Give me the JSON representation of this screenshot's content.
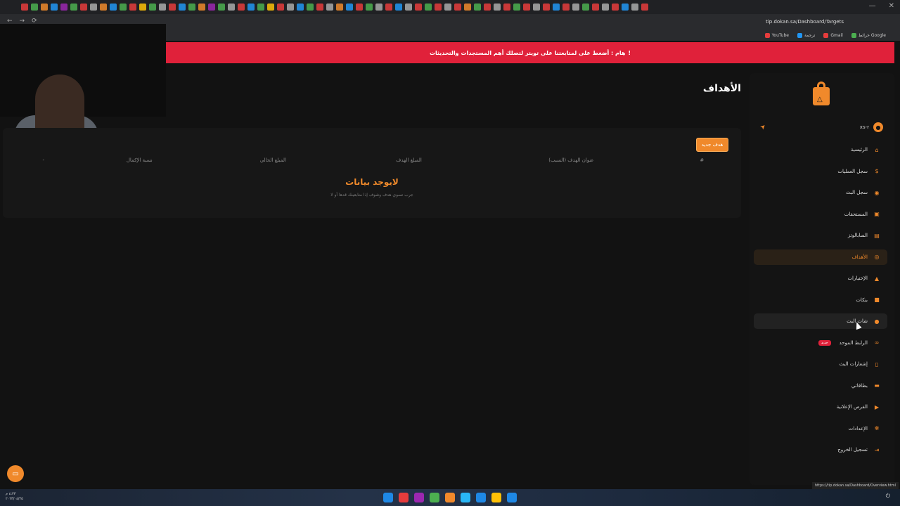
{
  "browser": {
    "url": "tip.dokan.sa/Dashboard/Targets",
    "tab_colors": [
      "#e63c3c",
      "#4caf50",
      "#f0892b",
      "#2196f3",
      "#9c27b0",
      "#4caf50",
      "#e63c3c",
      "#aaa",
      "#f0892b",
      "#2196f3",
      "#4caf50",
      "#e63c3c",
      "#ffc107",
      "#4caf50",
      "#aaa",
      "#e63c3c",
      "#2196f3",
      "#4caf50",
      "#f0892b",
      "#9c27b0",
      "#4caf50",
      "#aaa",
      "#e63c3c",
      "#2196f3",
      "#4caf50",
      "#ffc107",
      "#e63c3c",
      "#aaa",
      "#2196f3",
      "#4caf50",
      "#e63c3c",
      "#aaa",
      "#f0892b",
      "#2196f3",
      "#e63c3c",
      "#4caf50",
      "#aaa",
      "#e63c3c",
      "#2196f3",
      "#aaa",
      "#e63c3c",
      "#4caf50",
      "#e63c3c",
      "#aaa",
      "#e63c3c",
      "#f0892b",
      "#4caf50",
      "#e63c3c",
      "#aaa",
      "#e63c3c",
      "#4caf50",
      "#e63c3c",
      "#aaa",
      "#e63c3c",
      "#2196f3",
      "#e63c3c",
      "#aaa",
      "#4caf50",
      "#e63c3c",
      "#aaa",
      "#e63c3c",
      "#2196f3",
      "#aaa",
      "#e63c3c"
    ],
    "bookmarks": [
      {
        "label": "YouTube",
        "color": "#e63c3c"
      },
      {
        "label": "ترجمة",
        "color": "#2196f3"
      },
      {
        "label": "Gmail",
        "color": "#e63c3c"
      },
      {
        "label": "خرائط Google",
        "color": "#4caf50"
      }
    ],
    "status_url": "https://tip.dokan.sa/Dashboard/Overview.html"
  },
  "alert": {
    "text": "هام : أضغط على لمتابعتنا على تويتر لتصلك أهم المستجدات والتحديثات",
    "icon": "!"
  },
  "page": {
    "title": "الأهداف"
  },
  "card": {
    "new_button": "هدف جديد",
    "columns": [
      "#",
      "عنوان الهدف (السبب)",
      "المبلغ الهدف",
      "المبلغ الحالي",
      "نسبة الإكمال",
      "-"
    ],
    "empty_title": "لايوجد بيانات",
    "empty_sub": "جرب تسوي هدف وشوف إذا متابعينك قدها أو لا"
  },
  "sidebar": {
    "username": "xs-r",
    "items": [
      {
        "label": "الرئيسية",
        "icon": "home-icon",
        "glyph": "⌂",
        "state": ""
      },
      {
        "label": "سجل العمليات",
        "icon": "dollar-icon",
        "glyph": "$",
        "state": ""
      },
      {
        "label": "سجل البث",
        "icon": "broadcast-icon",
        "glyph": "◉",
        "state": ""
      },
      {
        "label": "المستحقات",
        "icon": "wallet-icon",
        "glyph": "▣",
        "state": ""
      },
      {
        "label": "السابالوتز",
        "icon": "document-icon",
        "glyph": "▤",
        "state": ""
      },
      {
        "label": "الأهداف",
        "icon": "target-icon",
        "glyph": "◎",
        "state": "active"
      },
      {
        "label": "الإختيارات",
        "icon": "vote-icon",
        "glyph": "▲",
        "state": ""
      },
      {
        "label": "بنكات",
        "icon": "bank-icon",
        "glyph": "■",
        "state": ""
      },
      {
        "label": "شات البث",
        "icon": "chat-icon",
        "glyph": "●",
        "state": "hover"
      },
      {
        "label": "الرابط الموحد",
        "icon": "link-icon",
        "glyph": "∞",
        "state": "",
        "badge": "جديد"
      },
      {
        "label": "إشعارات البث",
        "icon": "phone-icon",
        "glyph": "▯",
        "state": ""
      },
      {
        "label": "بطاقاتي",
        "icon": "card-icon",
        "glyph": "▬",
        "state": ""
      },
      {
        "label": "الفرص الإعلانية",
        "icon": "ad-icon",
        "glyph": "▶",
        "state": ""
      },
      {
        "label": "الإعدادات",
        "icon": "gear-icon",
        "glyph": "✻",
        "state": ""
      },
      {
        "label": "تسجيل الخروج",
        "icon": "logout-icon",
        "glyph": "⇥",
        "state": ""
      }
    ]
  },
  "taskbar": {
    "clock_time": "٤:٣٣ م",
    "clock_date": "٢٠٢٣/٠٤/٢٥",
    "icon_colors": [
      "#1e88e5",
      "#e63c3c",
      "#9c27b0",
      "#4caf50",
      "#f0892b",
      "#29b6f6",
      "#1e88e5",
      "#ffc107",
      "#1e88e5"
    ]
  }
}
